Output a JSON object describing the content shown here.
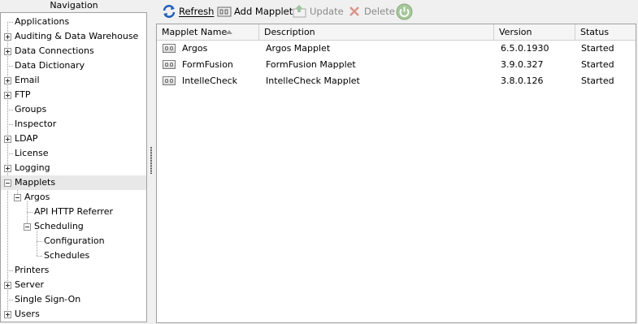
{
  "navigation": {
    "title": "Navigation",
    "items": [
      {
        "label": "Applications",
        "expander": "none",
        "depth": 0
      },
      {
        "label": "Auditing & Data Warehouse",
        "expander": "plus",
        "depth": 0
      },
      {
        "label": "Data Connections",
        "expander": "plus",
        "depth": 0
      },
      {
        "label": "Data Dictionary",
        "expander": "none",
        "depth": 0
      },
      {
        "label": "Email",
        "expander": "plus",
        "depth": 0
      },
      {
        "label": "FTP",
        "expander": "plus",
        "depth": 0
      },
      {
        "label": "Groups",
        "expander": "none",
        "depth": 0
      },
      {
        "label": "Inspector",
        "expander": "none",
        "depth": 0
      },
      {
        "label": "LDAP",
        "expander": "plus",
        "depth": 0
      },
      {
        "label": "License",
        "expander": "none",
        "depth": 0
      },
      {
        "label": "Logging",
        "expander": "plus",
        "depth": 0
      },
      {
        "label": "Mapplets",
        "expander": "minus",
        "depth": 0,
        "selected": true
      },
      {
        "label": "Argos",
        "expander": "minus",
        "depth": 1
      },
      {
        "label": "API HTTP Referrer",
        "expander": "none",
        "depth": 2
      },
      {
        "label": "Scheduling",
        "expander": "minus",
        "depth": 2
      },
      {
        "label": "Configuration",
        "expander": "none",
        "depth": 3
      },
      {
        "label": "Schedules",
        "expander": "none",
        "depth": 3
      },
      {
        "label": "Printers",
        "expander": "none",
        "depth": 0
      },
      {
        "label": "Server",
        "expander": "plus",
        "depth": 0
      },
      {
        "label": "Single Sign-On",
        "expander": "none",
        "depth": 0
      },
      {
        "label": "Users",
        "expander": "plus",
        "depth": 0
      }
    ]
  },
  "toolbar": {
    "refresh_label": "Refresh",
    "add_label": "Add Mapplet",
    "update_label": "Update",
    "delete_label": "Delete",
    "refresh_icon": "refresh-icon",
    "add_icon": "add-mapplet-icon",
    "update_icon": "update-icon",
    "delete_icon": "delete-icon",
    "power_icon": "power-icon"
  },
  "table": {
    "columns": [
      "Mapplet Name",
      "Description",
      "Version",
      "Status"
    ],
    "sorted_column": "Mapplet Name",
    "sort_direction": "ascending",
    "rows": [
      {
        "name": "Argos",
        "description": "Argos Mapplet",
        "version": "6.5.0.1930",
        "status": "Started"
      },
      {
        "name": "FormFusion",
        "description": "FormFusion Mapplet",
        "version": "3.9.0.327",
        "status": "Started"
      },
      {
        "name": "IntelleCheck",
        "description": "IntelleCheck Mapplet",
        "version": "3.8.0.126",
        "status": "Started"
      }
    ]
  },
  "colors": {
    "refresh_blue": "#1f5fb8",
    "delete_red": "#d24a3a",
    "power_green": "#7fae6a"
  }
}
